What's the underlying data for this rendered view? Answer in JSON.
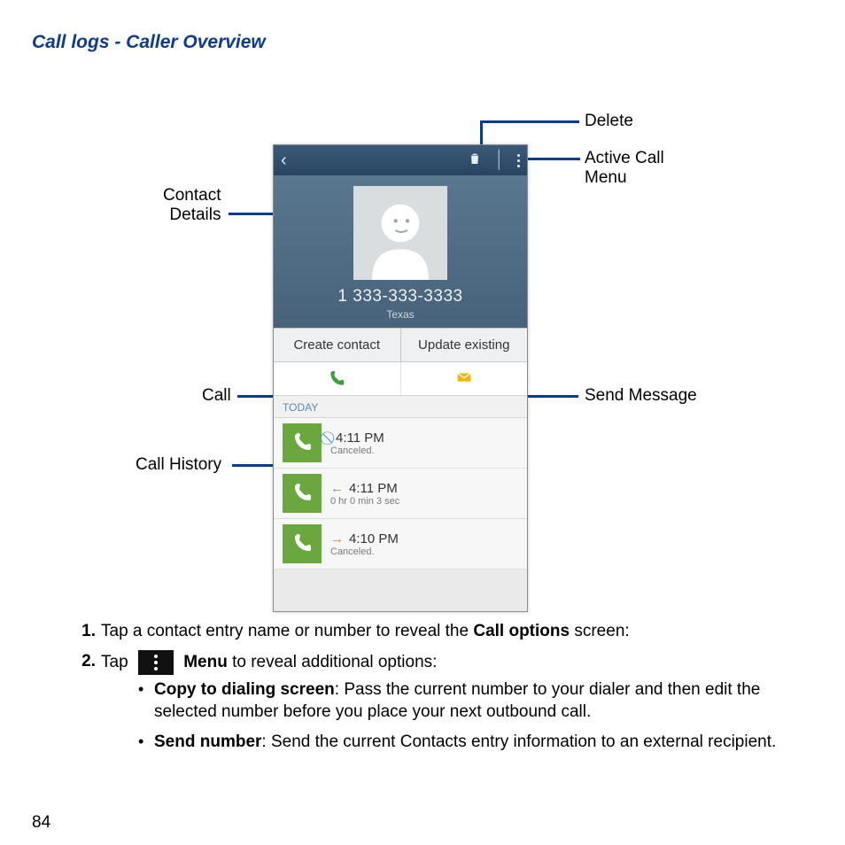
{
  "title": "Call logs - Caller Overview",
  "callouts": {
    "delete": "Delete",
    "active_menu_l1": "Active Call",
    "active_menu_l2": "Menu",
    "contact_details_l1": "Contact",
    "contact_details_l2": "Details",
    "call": "Call",
    "send_message": "Send Message",
    "call_history": "Call History"
  },
  "phone": {
    "number": "1 333-333-3333",
    "location": "Texas",
    "create_contact": "Create contact",
    "update_existing": "Update existing",
    "today": "TODAY",
    "logs": [
      {
        "time": "4:11 PM",
        "sub": "Canceled.",
        "dir": "blocked"
      },
      {
        "time": "4:11 PM",
        "sub": "0 hr 0 min 3 sec",
        "dir": "in"
      },
      {
        "time": "4:10 PM",
        "sub": "Canceled.",
        "dir": "out"
      }
    ]
  },
  "steps": {
    "s1_pre": "Tap a contact entry name or number to reveal the ",
    "s1_bold": "Call options",
    "s1_post": " screen:",
    "s2_pre": "Tap ",
    "s2_menu_word": "Menu",
    "s2_post": " to reveal additional options:",
    "opt1_bold": "Copy to dialing screen",
    "opt1_rest": ": Pass the current number to your dialer and then edit the selected number before you place your next outbound call.",
    "opt2_bold": "Send number",
    "opt2_rest": ": Send the current Contacts entry information to an external recipient."
  },
  "page_number": "84"
}
